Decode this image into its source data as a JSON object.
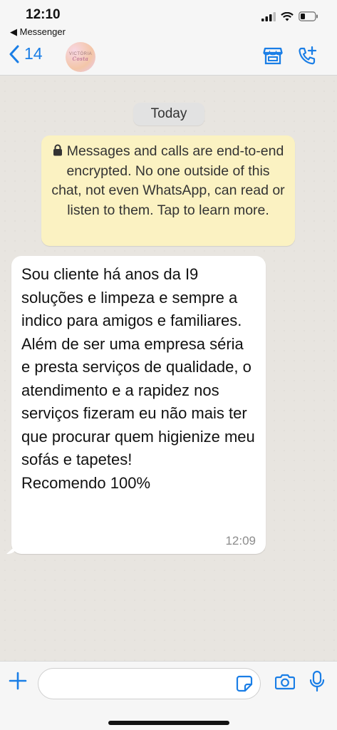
{
  "status_bar": {
    "time": "12:10",
    "back_app": "◀ Messenger"
  },
  "header": {
    "back_count": "14",
    "avatar_line1": "VICTÓRIA",
    "avatar_line2": "Costa"
  },
  "chat": {
    "date_label": "Today",
    "encryption_notice": "Messages and calls are end-to-end encrypted. No one outside of this chat, not even WhatsApp, can read or listen to them. Tap to learn more.",
    "message": {
      "text": "Sou cliente há anos da I9 soluções e limpeza e sempre a indico para amigos e familiares. Além de ser uma empresa séria e presta serviços de qualidade, o atendimento e a rapidez nos serviços fizeram eu não mais ter que procurar quem higienize meu sofás e tapetes!\nRecomendo 100%",
      "time": "12:09"
    }
  },
  "composer": {
    "placeholder": ""
  },
  "colors": {
    "accent": "#1a7ee6",
    "bubble": "#ffffff",
    "notice": "#fbf2c2",
    "background": "#e8e5e0"
  },
  "icons": [
    "back-chevron",
    "store-icon",
    "add-call-icon",
    "plus-icon",
    "sticker-icon",
    "camera-icon",
    "mic-icon",
    "lock-icon",
    "signal-icon",
    "wifi-icon",
    "battery-icon"
  ]
}
